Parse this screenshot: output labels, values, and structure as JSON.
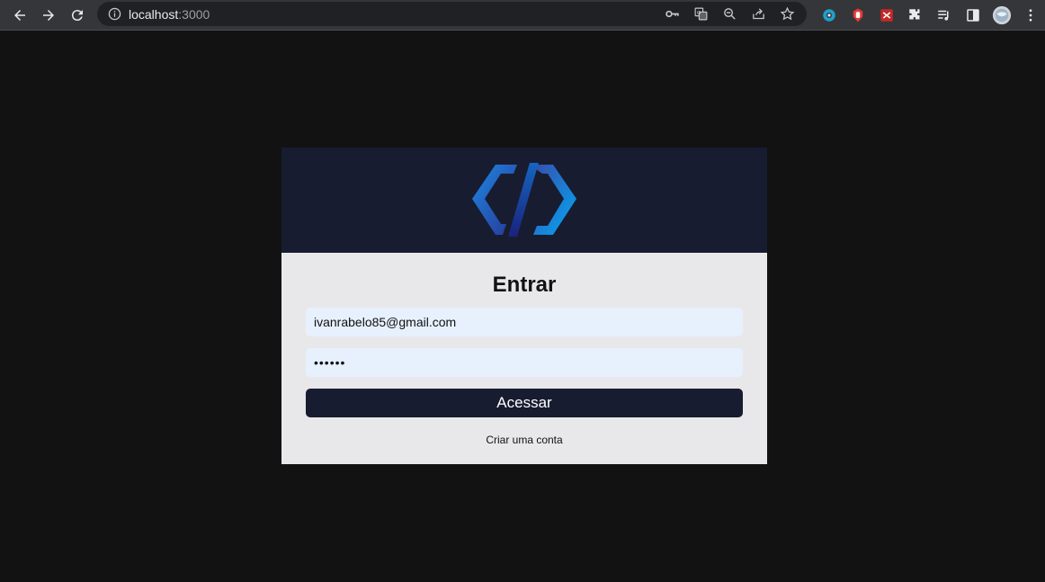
{
  "browser": {
    "url_host": "localhost",
    "url_port": ":3000",
    "nav": {
      "back_icon": "arrow-left-icon",
      "forward_icon": "arrow-right-icon",
      "reload_icon": "reload-icon",
      "info_icon": "info-icon"
    },
    "omnibox_icons": [
      "key-icon",
      "translate-icon",
      "zoom-out-icon",
      "share-icon",
      "star-icon"
    ],
    "extension_icons": [
      "extension-blue-icon",
      "extension-red-hand-icon",
      "extension-bug-icon",
      "puzzle-icon",
      "media-queue-icon",
      "side-panel-icon",
      "profile-avatar",
      "kebab-menu-icon"
    ]
  },
  "login": {
    "logo": "code-logo",
    "title": "Entrar",
    "email_value": "ivanrabelo85@gmail.com",
    "password_value": "••••••",
    "submit_label": "Acessar",
    "signup_link": "Criar uma conta"
  },
  "colors": {
    "page_bg": "#121212",
    "header_bg": "#181c30",
    "card_bg": "#e8e8ea",
    "input_bg": "#e7f0fd",
    "button_bg": "#181c30",
    "logo_blue": "#1a73e8"
  }
}
